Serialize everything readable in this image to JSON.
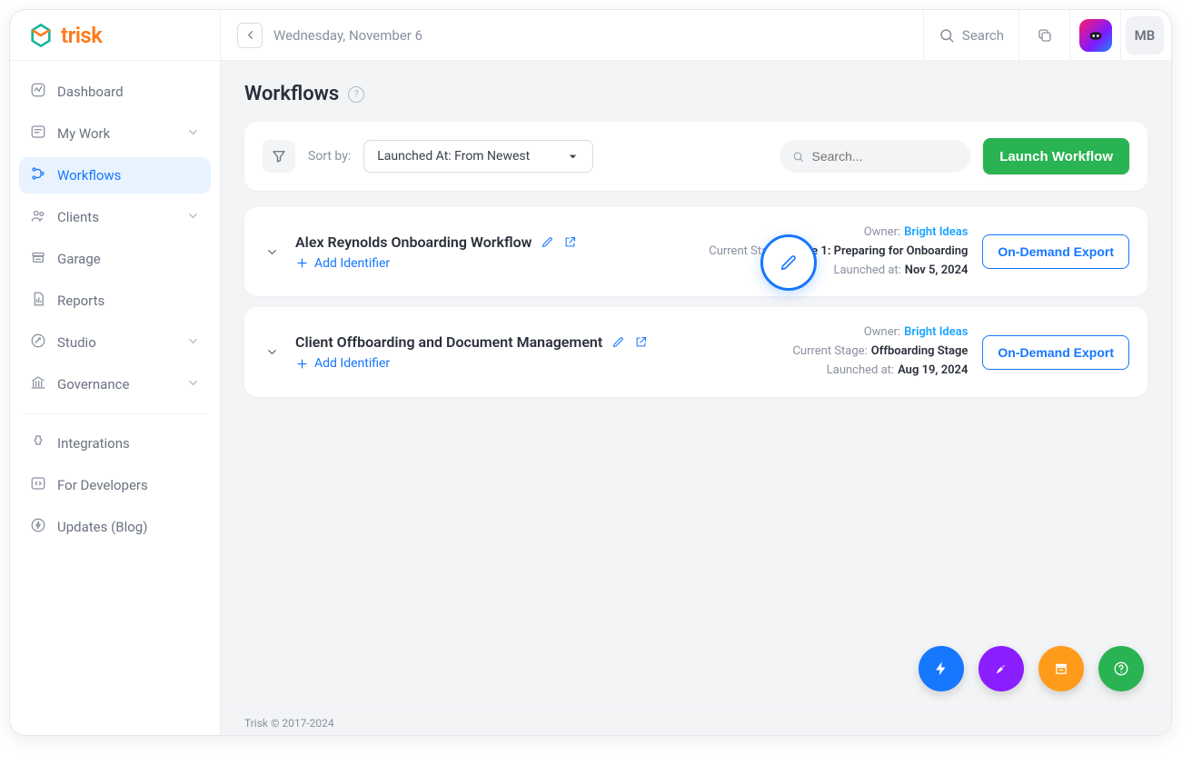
{
  "brand": {
    "name": "trisk"
  },
  "header": {
    "date": "Wednesday, November 6",
    "search_placeholder": "Search",
    "user_initials": "MB"
  },
  "sidebar": {
    "items": [
      {
        "label": "Dashboard",
        "icon": "activity",
        "expandable": false
      },
      {
        "label": "My Work",
        "icon": "mywork",
        "expandable": true
      },
      {
        "label": "Workflows",
        "icon": "workflows",
        "expandable": false,
        "active": true
      },
      {
        "label": "Clients",
        "icon": "clients",
        "expandable": true
      },
      {
        "label": "Garage",
        "icon": "garage",
        "expandable": false
      },
      {
        "label": "Reports",
        "icon": "reports",
        "expandable": false
      },
      {
        "label": "Studio",
        "icon": "studio",
        "expandable": true
      },
      {
        "label": "Governance",
        "icon": "governance",
        "expandable": true
      }
    ],
    "secondary": [
      {
        "label": "Integrations",
        "icon": "puzzle"
      },
      {
        "label": "For Developers",
        "icon": "code"
      },
      {
        "label": "Updates (Blog)",
        "icon": "zap"
      }
    ]
  },
  "page": {
    "title": "Workflows",
    "sort_by_label": "Sort by:",
    "sort_value": "Launched At: From Newest",
    "search_placeholder": "Search...",
    "launch_button": "Launch Workflow",
    "export_button": "On-Demand Export",
    "add_identifier": "Add Identifier",
    "meta_labels": {
      "owner": "Owner:",
      "current_stage": "Current Stage:",
      "launched_at": "Launched at:"
    }
  },
  "workflows": [
    {
      "title": "Alex Reynolds Onboarding Workflow",
      "owner": "Bright Ideas",
      "current_stage": "Stage 1: Preparing for Onboarding",
      "launched_at": "Nov 5, 2024",
      "show_edit": true,
      "show_open": true
    },
    {
      "title": "Client Offboarding and Document Management",
      "owner": "Bright Ideas",
      "current_stage": "Offboarding Stage",
      "launched_at": "Aug 19, 2024",
      "show_edit": true,
      "show_open": true
    }
  ],
  "footer": {
    "copyright": "Trisk © 2017-2024"
  }
}
